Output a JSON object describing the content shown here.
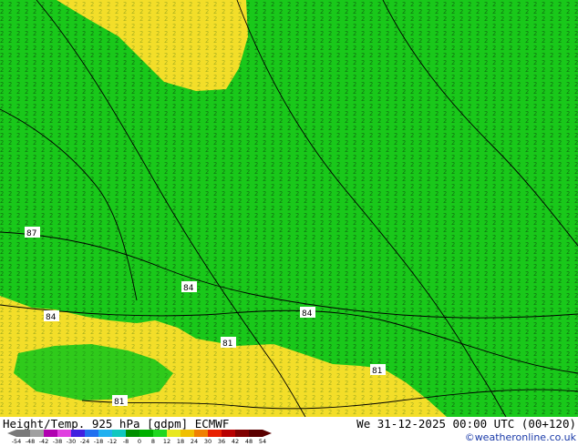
{
  "map": {
    "contour_labels": [
      "87",
      "84",
      "84",
      "84",
      "81",
      "81",
      "81"
    ]
  },
  "footer": {
    "title": "Height/Temp. 925 hPa [gdpm] ECMWF",
    "datetime": "We 31-12-2025 00:00 UTC (00+120)",
    "credit": "©weatheronline.co.uk"
  },
  "scale": {
    "ticks": [
      "-54",
      "-48",
      "-42",
      "-38",
      "-30",
      "-24",
      "-18",
      "-12",
      "-8",
      "0",
      "8",
      "12",
      "18",
      "24",
      "30",
      "36",
      "42",
      "48",
      "54"
    ],
    "colors": [
      "#7a7a7a",
      "#a0a0a0",
      "#b000b0",
      "#e040e0",
      "#4020e0",
      "#2070f0",
      "#20b0f0",
      "#10c8c0",
      "#009000",
      "#00b000",
      "#20d820",
      "#e8e820",
      "#f0c000",
      "#f08000",
      "#e82000",
      "#b80000",
      "#800000",
      "#5a0000"
    ]
  },
  "colors": {
    "green": "#19c81a",
    "yellow": "#f3de29",
    "contour": "#000000"
  }
}
